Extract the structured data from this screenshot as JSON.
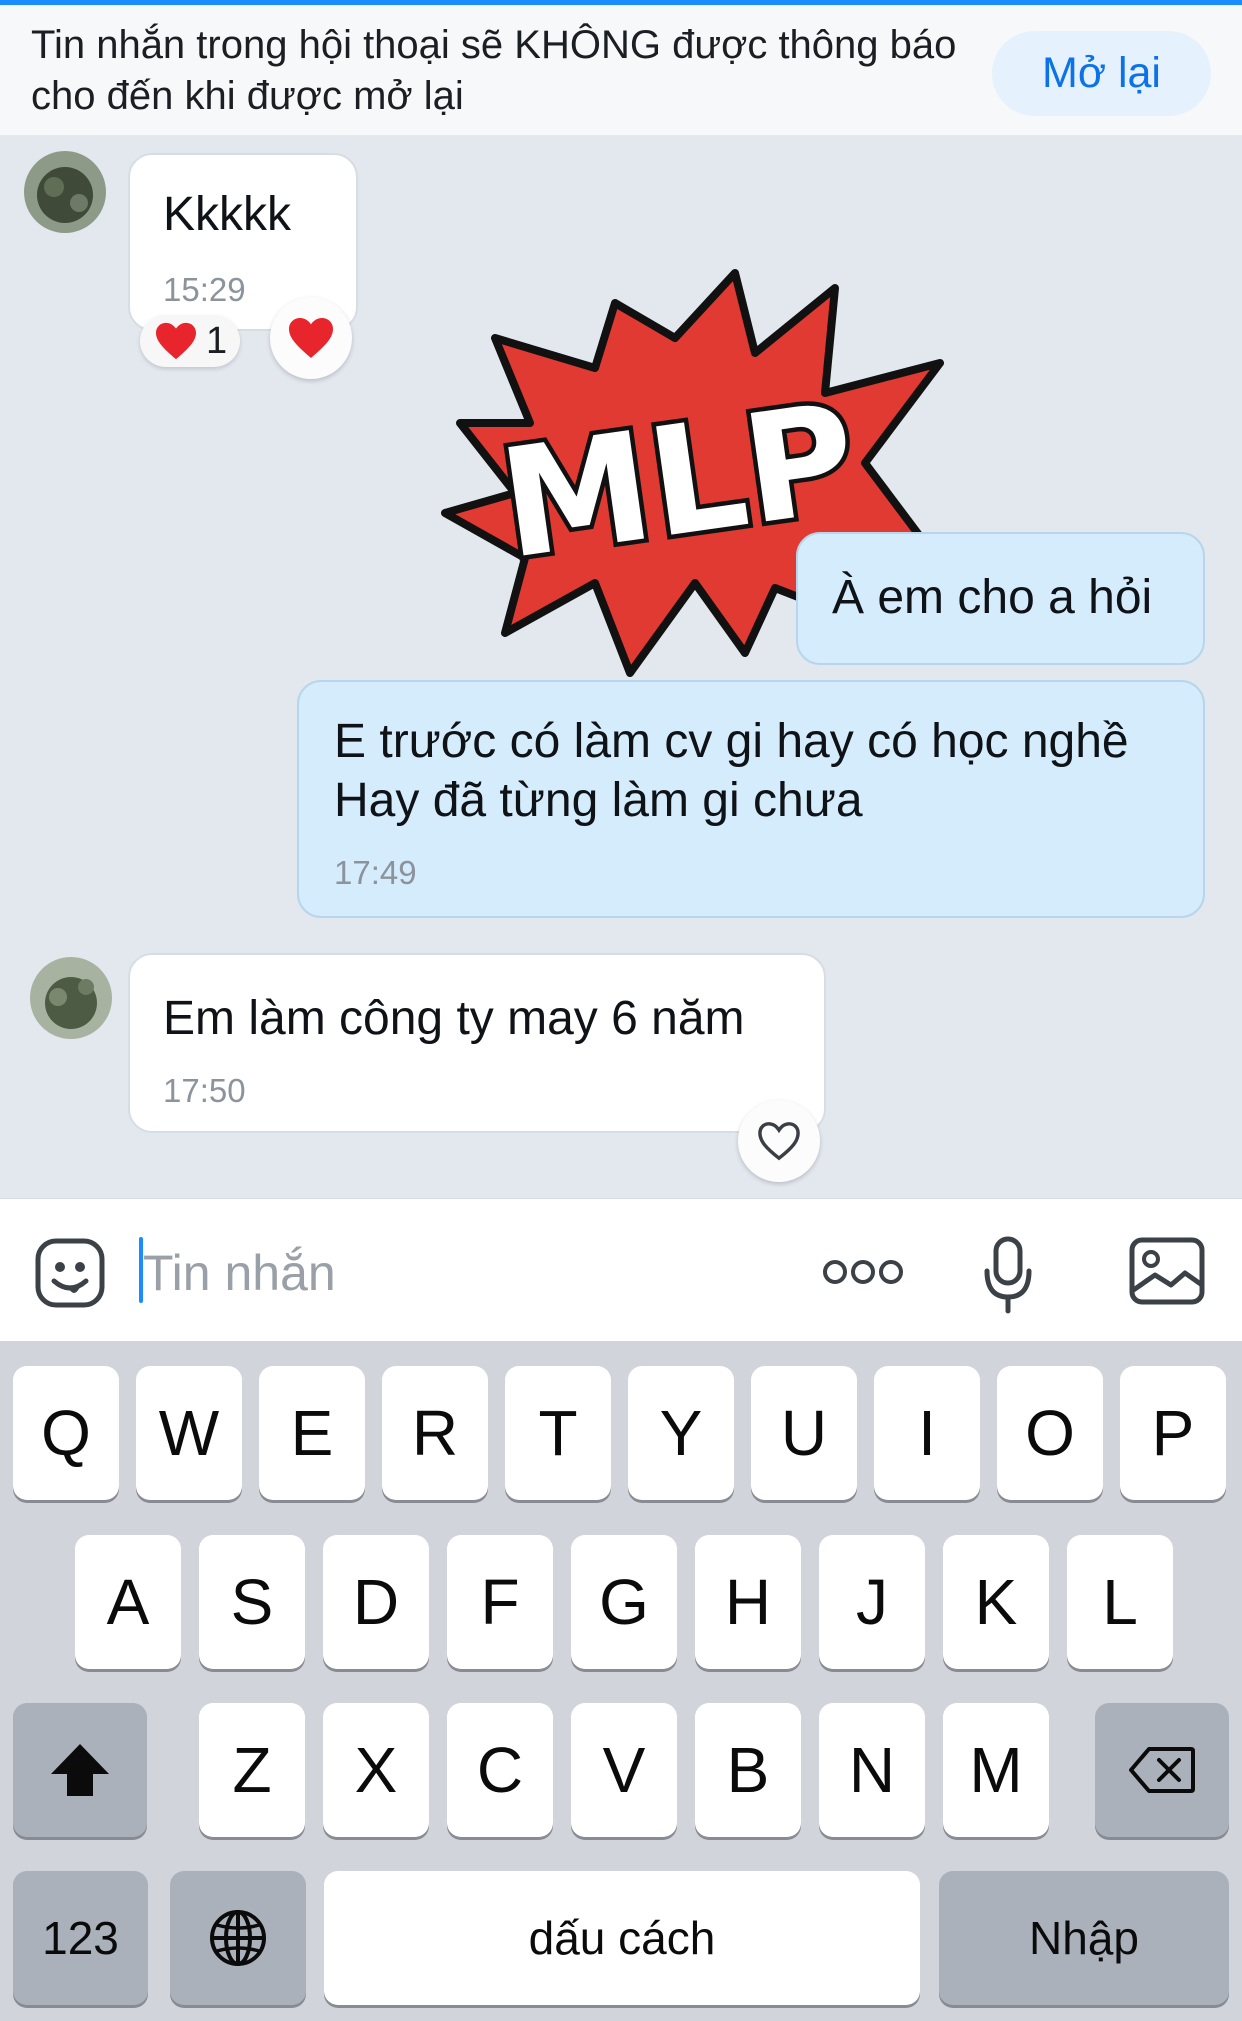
{
  "banner": {
    "notice": "Tin nhắn trong hội thoại sẽ KHÔNG được thông báo cho đến khi được mở lại",
    "reopen_label": "Mở lại"
  },
  "messages": [
    {
      "id": "m1",
      "direction": "incoming",
      "text": "Kkkkk",
      "time": "15:29",
      "reaction_count": "1"
    },
    {
      "id": "sticker",
      "direction": "outgoing",
      "sticker_text": "MLP"
    },
    {
      "id": "m2",
      "direction": "outgoing",
      "text": "À em cho a hỏi"
    },
    {
      "id": "m3",
      "direction": "outgoing",
      "lines": [
        "E trước có làm cv gi hay có học nghề",
        "Hay đã từng làm gi chưa"
      ],
      "time": "17:49"
    },
    {
      "id": "m4",
      "direction": "incoming",
      "text": "Em làm  công ty may 6 năm",
      "time": "17:50"
    }
  ],
  "composer": {
    "placeholder": "Tin nhắn",
    "icons": [
      "emoji-icon",
      "more-icon",
      "microphone-icon",
      "image-icon"
    ]
  },
  "keyboard": {
    "row1": [
      "Q",
      "W",
      "E",
      "R",
      "T",
      "Y",
      "U",
      "I",
      "O",
      "P"
    ],
    "row2": [
      "A",
      "S",
      "D",
      "F",
      "G",
      "H",
      "J",
      "K",
      "L"
    ],
    "row3": [
      "Z",
      "X",
      "C",
      "V",
      "B",
      "N",
      "M"
    ],
    "numbers_label": "123",
    "space_label": "dấu cách",
    "return_label": "Nhập"
  },
  "colors": {
    "accent": "#0b72e7",
    "chat_background": "#e3e8ef",
    "outgoing_bubble": "#d4ecfb",
    "incoming_bubble": "#ffffff",
    "sticker_red": "#e03a32"
  }
}
